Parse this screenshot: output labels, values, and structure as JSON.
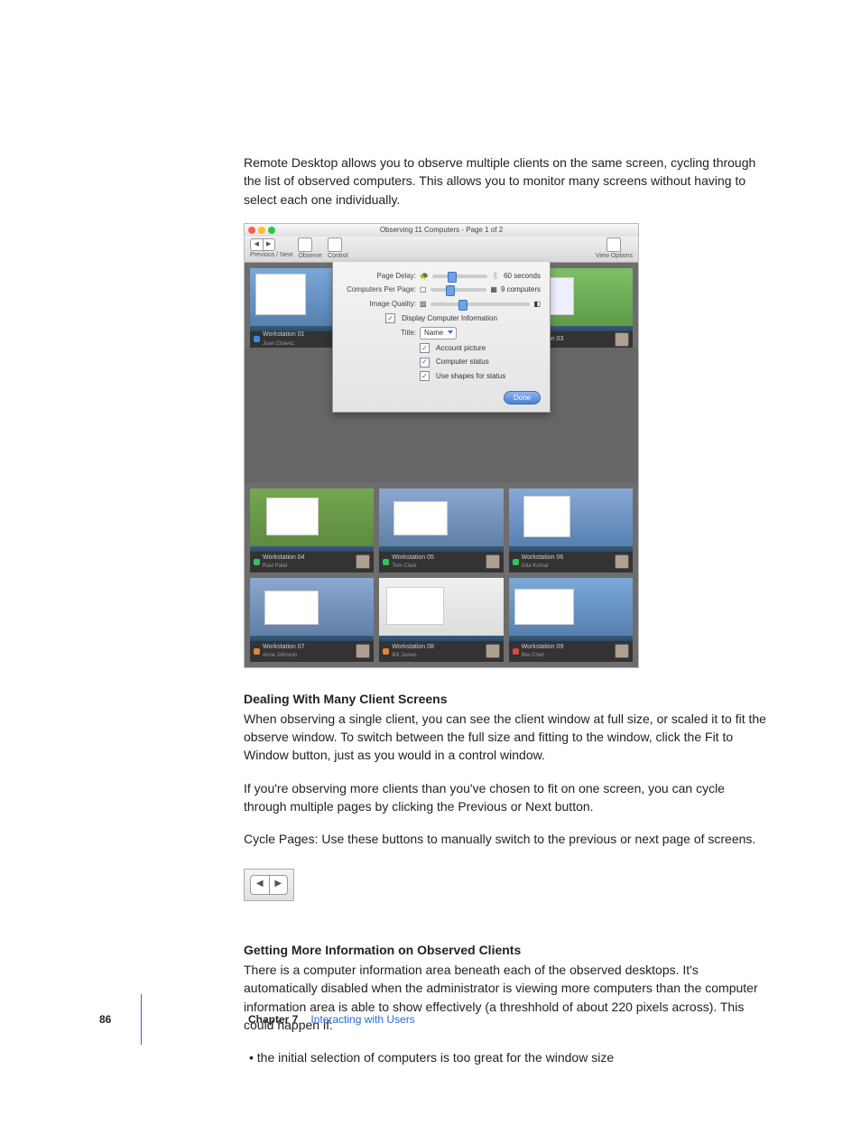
{
  "intro": "Remote Desktop allows you to observe multiple clients on the same screen, cycling through the list of observed computers. This allows you to monitor many screens without having to select each one individually.",
  "figure1": {
    "window_title": "Observing 11 Computers - Page 1 of 2",
    "toolbar": {
      "prev_next": "Previous / Next",
      "observe": "Observe",
      "control": "Control",
      "view_options": "View Options"
    },
    "sheet": {
      "page_delay_label": "Page Delay:",
      "page_delay_value": "60 seconds",
      "computers_label": "Computers Per Page:",
      "computers_value": "9 computers",
      "quality_label": "Image Quality:",
      "display_info": "Display Computer Information",
      "title_label": "Title:",
      "title_value": "Name",
      "account_picture": "Account picture",
      "computer_status": "Computer status",
      "shapes_for_status": "Use shapes for status",
      "done": "Done"
    },
    "cells": [
      {
        "name": "Workstation 01",
        "user": "Juan Chavez",
        "status": "blue"
      },
      {
        "name": "",
        "user": "",
        "status": ""
      },
      {
        "name": "Workstation 03",
        "user": "—",
        "status": "blue"
      },
      {
        "name": "Workstation 04",
        "user": "Ravi Patel",
        "status": "green"
      },
      {
        "name": "Workstation 05",
        "user": "Tom Clark",
        "status": "green"
      },
      {
        "name": "Workstation 06",
        "user": "Gita Kumar",
        "status": "green"
      },
      {
        "name": "Workstation 07",
        "user": "Anne Johnson",
        "status": "orange"
      },
      {
        "name": "Workstation 08",
        "user": "Bill James",
        "status": "orange"
      },
      {
        "name": "Workstation 09",
        "user": "Mei Chen",
        "status": "red"
      }
    ]
  },
  "h1": "Dealing With Many Client Screens",
  "p1": "When observing a single client, you can see the client window at full size, or scaled it to fit the observe window. To switch between the full size and fitting to the window, click the Fit to Window button, just as you would in a control window.",
  "p2": "If you're observing more clients than you've chosen to fit on one screen, you can cycle through multiple pages by clicking the Previous or Next button.",
  "p3": "Cycle Pages:  Use these buttons to manually switch to the previous or next page of screens.",
  "h2": "Getting More Information on Observed Clients",
  "p4": "There is a computer information area beneath each of the observed desktops. It's automatically disabled when the administrator is viewing more computers than the computer information area is able to show effectively (a threshhold of about 220 pixels across). This could happen if:",
  "b1": "the initial selection of computers is too great for the window size",
  "footer": {
    "page": "86",
    "chapter": "Chapter 7",
    "title": "Interacting with Users"
  }
}
